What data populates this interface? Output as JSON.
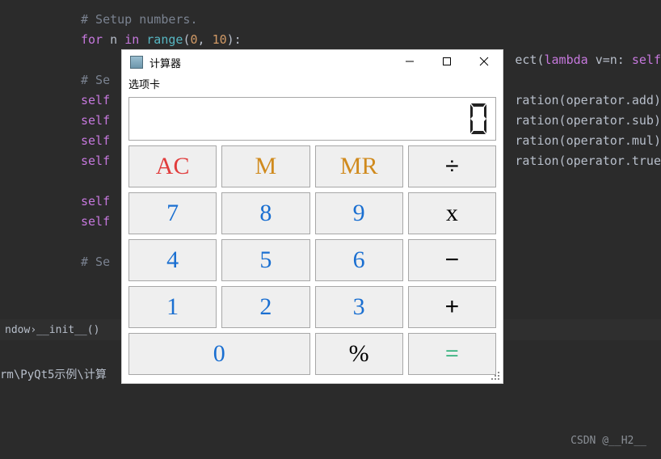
{
  "editor": {
    "lines": [
      {
        "cls": "cmt",
        "text": "# Setup numbers."
      },
      {
        "raw": [
          [
            "kw",
            "for "
          ],
          [
            "plain",
            "n "
          ],
          [
            "kw",
            "in "
          ],
          [
            "fn",
            "range"
          ],
          [
            "plain",
            "("
          ],
          [
            "num",
            "0"
          ],
          [
            "plain",
            ", "
          ],
          [
            "num",
            "10"
          ],
          [
            "plain",
            "):"
          ]
        ]
      },
      {
        "tail": [
          [
            "plain",
            "ect("
          ],
          [
            "kw",
            "lambda "
          ],
          [
            "plain",
            "v=n: "
          ],
          [
            "self",
            "self"
          ]
        ]
      },
      {
        "text": ""
      },
      {
        "raw": [
          [
            "cmt",
            "# Se"
          ]
        ]
      },
      {
        "raw": [
          [
            "self",
            "self"
          ]
        ],
        "tail": [
          [
            "plain",
            "ration(operator.add)"
          ]
        ]
      },
      {
        "raw": [
          [
            "self",
            "self"
          ]
        ],
        "tail": [
          [
            "plain",
            "ration(operator.sub)"
          ]
        ]
      },
      {
        "raw": [
          [
            "self",
            "self"
          ]
        ],
        "tail": [
          [
            "plain",
            "ration(operator.mul)"
          ]
        ]
      },
      {
        "raw": [
          [
            "self",
            "self"
          ]
        ],
        "tail": [
          [
            "plain",
            "ration(operator.true"
          ]
        ]
      },
      {
        "text": ""
      },
      {
        "raw": [
          [
            "self",
            "self"
          ]
        ]
      },
      {
        "raw": [
          [
            "self",
            "self"
          ]
        ]
      },
      {
        "text": ""
      },
      {
        "raw": [
          [
            "cmt",
            "# Se"
          ]
        ]
      }
    ]
  },
  "pathbar": {
    "left": "ndow",
    "sep": "  ›  ",
    "right": "__init__()"
  },
  "terminal": {
    "line": "rm\\PyQt5示例\\计算"
  },
  "watermark": "CSDN @__H2__",
  "window": {
    "title": "计算器",
    "menu": "选项卡",
    "display_value": "0",
    "buttons": {
      "rows": [
        [
          {
            "id": "ac",
            "label": "AC",
            "style": "red"
          },
          {
            "id": "m",
            "label": "M",
            "style": "orange"
          },
          {
            "id": "mr",
            "label": "MR",
            "style": "orange"
          },
          {
            "id": "div",
            "label": "÷",
            "style": "black"
          }
        ],
        [
          {
            "id": "7",
            "label": "7",
            "style": "blue"
          },
          {
            "id": "8",
            "label": "8",
            "style": "blue"
          },
          {
            "id": "9",
            "label": "9",
            "style": "blue"
          },
          {
            "id": "mul",
            "label": "x",
            "style": "blackserif"
          }
        ],
        [
          {
            "id": "4",
            "label": "4",
            "style": "blue"
          },
          {
            "id": "5",
            "label": "5",
            "style": "blue"
          },
          {
            "id": "6",
            "label": "6",
            "style": "blue"
          },
          {
            "id": "sub",
            "label": "−",
            "style": "black"
          }
        ],
        [
          {
            "id": "1",
            "label": "1",
            "style": "blue"
          },
          {
            "id": "2",
            "label": "2",
            "style": "blue"
          },
          {
            "id": "3",
            "label": "3",
            "style": "blue"
          },
          {
            "id": "add",
            "label": "+",
            "style": "black"
          }
        ],
        [
          {
            "id": "0",
            "label": "0",
            "style": "blue",
            "span": 2
          },
          {
            "id": "pct",
            "label": "%",
            "style": "blackserif"
          },
          {
            "id": "eq",
            "label": "=",
            "style": "green"
          }
        ]
      ]
    }
  }
}
